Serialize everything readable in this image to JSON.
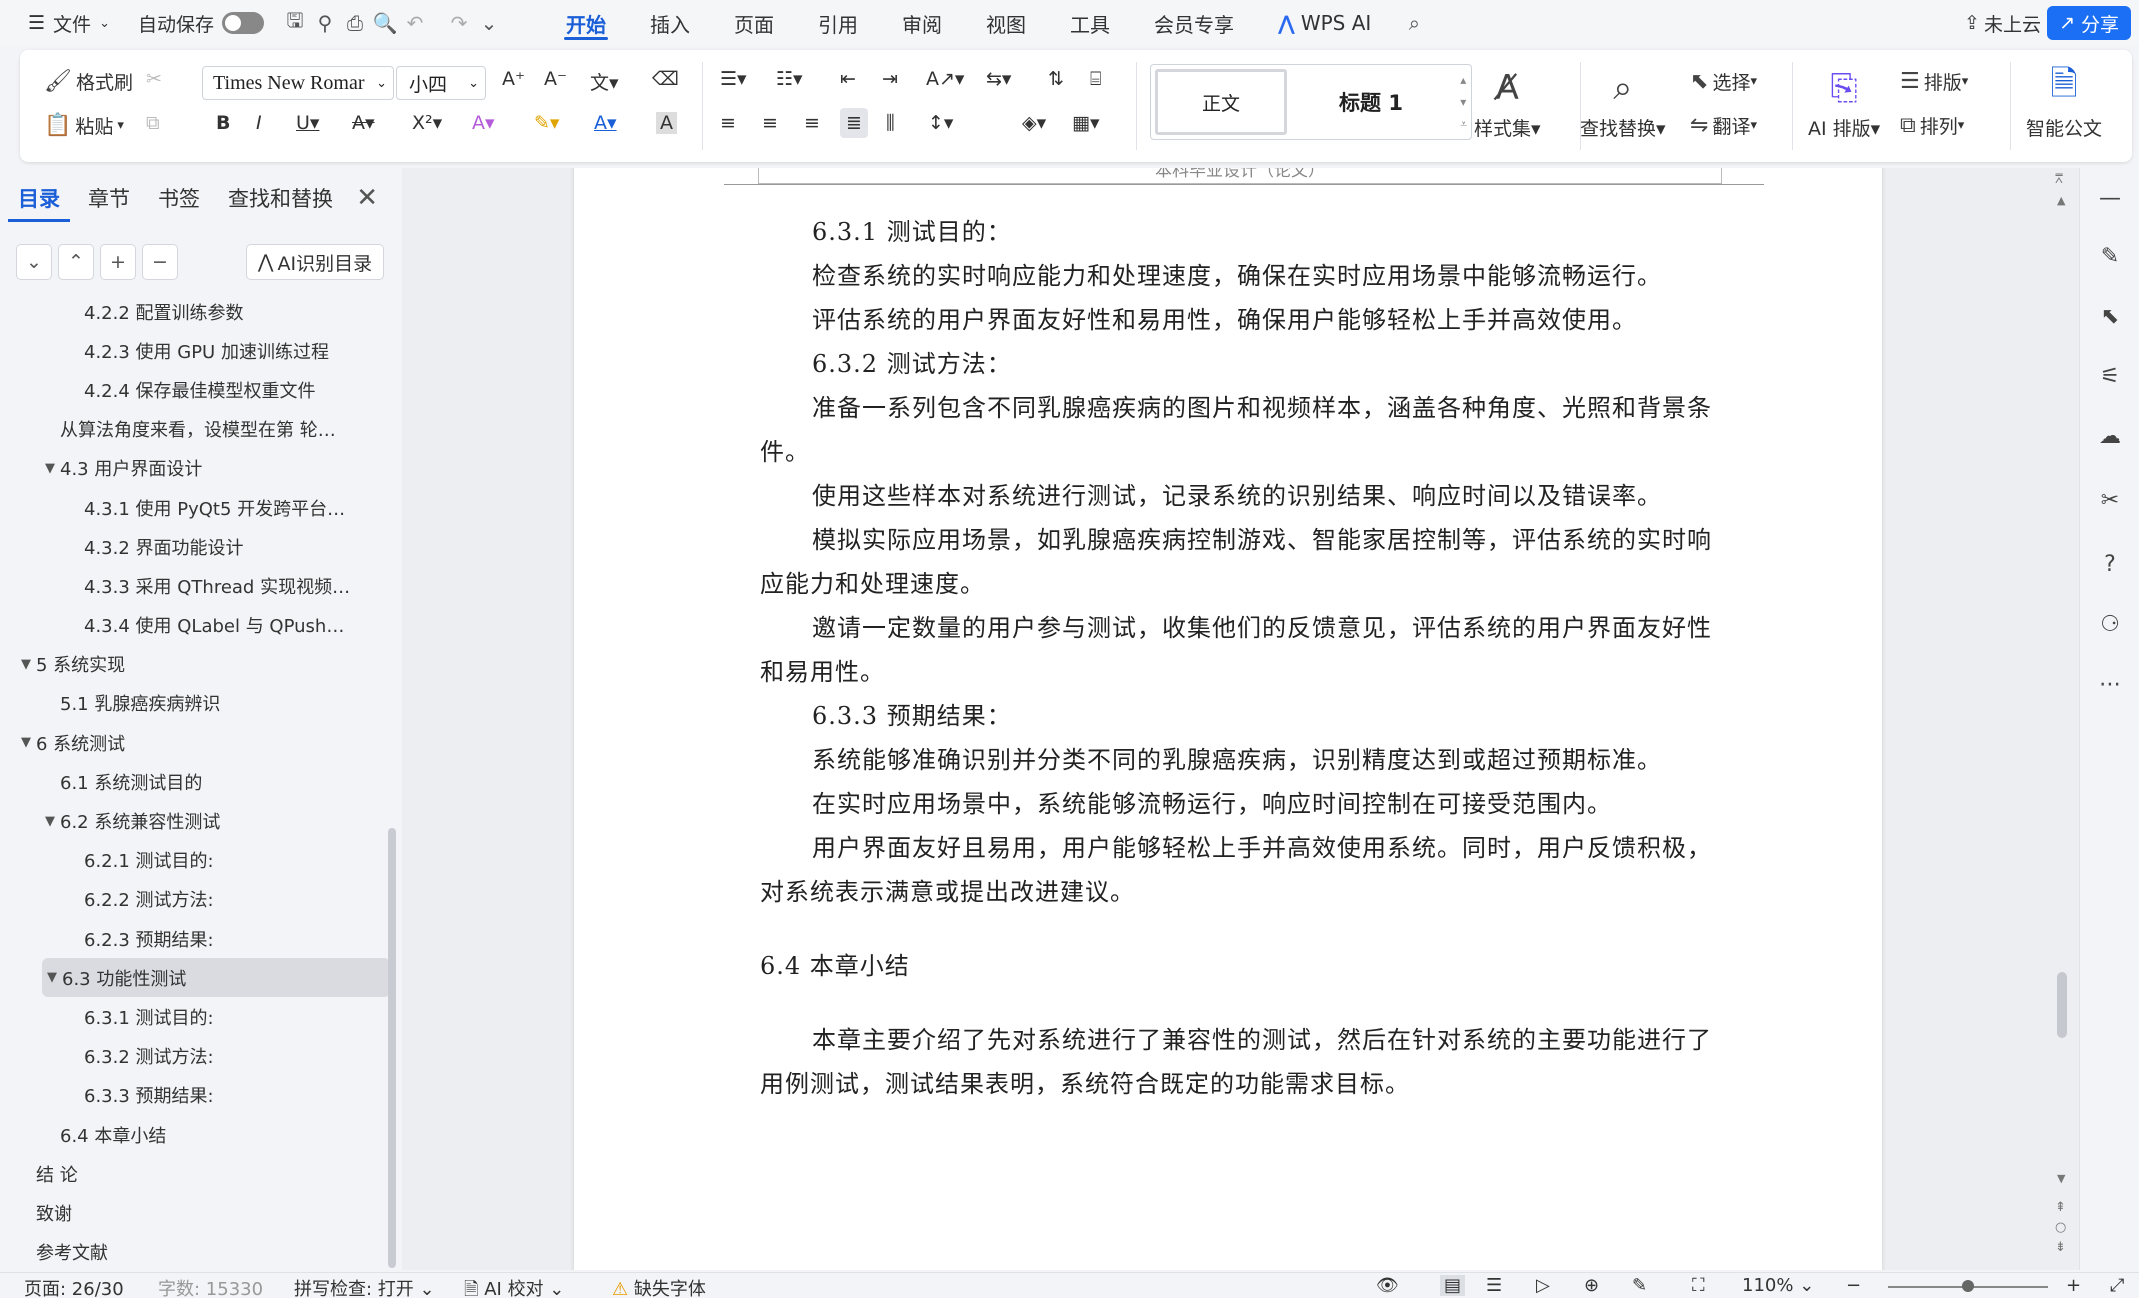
{
  "menubar": {
    "menu_label": "文件",
    "autosave_label": "自动保存",
    "tabs": [
      "开始",
      "插入",
      "页面",
      "引用",
      "审阅",
      "视图",
      "工具",
      "会员专享",
      "WPS AI"
    ],
    "active_tab": "开始",
    "cloud_label": "未上云",
    "share_label": "分享"
  },
  "ribbon": {
    "format_painter": "格式刷",
    "paste": "粘贴",
    "font_name": "Times New Romar",
    "font_size": "小四",
    "style_normal": "正文",
    "style_heading1": "标题 1",
    "style_set": "样式集",
    "find_replace": "查找替换",
    "select": "选择",
    "translate": "翻译",
    "ai_layout": "AI 排版",
    "typeset": "排版",
    "arrange": "排列",
    "smart_doc": "智能公文"
  },
  "nav": {
    "tabs": [
      "目录",
      "章节",
      "书签",
      "查找和替换"
    ],
    "active_tab": "目录",
    "ai_toc_label": "AI识别目录",
    "items": [
      {
        "text": "4.2.2 配置训练参数",
        "level": 3,
        "caret": ""
      },
      {
        "text": "4.2.3 使用 GPU 加速训练过程",
        "level": 3,
        "caret": ""
      },
      {
        "text": "4.2.4 保存最佳模型权重文件",
        "level": 3,
        "caret": ""
      },
      {
        "text": "从算法角度来看，设模型在第 轮…",
        "level": 2,
        "caret": ""
      },
      {
        "text": "4.3 用户界面设计",
        "level": 2,
        "caret": "▼"
      },
      {
        "text": "4.3.1 使用 PyQt5 开发跨平台…",
        "level": 3,
        "caret": ""
      },
      {
        "text": "4.3.2 界面功能设计",
        "level": 3,
        "caret": ""
      },
      {
        "text": "4.3.3 采用 QThread 实现视频…",
        "level": 3,
        "caret": ""
      },
      {
        "text": "4.3.4 使用 QLabel 与 QPush…",
        "level": 3,
        "caret": ""
      },
      {
        "text": "5 系统实现",
        "level": 1,
        "caret": "▼"
      },
      {
        "text": "5.1 乳腺癌疾病辨识",
        "level": 2,
        "caret": ""
      },
      {
        "text": "6 系统测试",
        "level": 1,
        "caret": "▼"
      },
      {
        "text": "6.1 系统测试目的",
        "level": 2,
        "caret": ""
      },
      {
        "text": "6.2 系统兼容性测试",
        "level": 2,
        "caret": "▼"
      },
      {
        "text": "6.2.1 测试目的:",
        "level": 3,
        "caret": ""
      },
      {
        "text": "6.2.2 测试方法:",
        "level": 3,
        "caret": ""
      },
      {
        "text": "6.2.3 预期结果:",
        "level": 3,
        "caret": ""
      },
      {
        "text": "6.3 功能性测试",
        "level": 2,
        "caret": "▼",
        "selected": true
      },
      {
        "text": "6.3.1 测试目的:",
        "level": 3,
        "caret": ""
      },
      {
        "text": "6.3.2 测试方法:",
        "level": 3,
        "caret": ""
      },
      {
        "text": "6.3.3 预期结果:",
        "level": 3,
        "caret": ""
      },
      {
        "text": "6.4 本章小结",
        "level": 2,
        "caret": ""
      },
      {
        "text": "结  论",
        "level": 1,
        "caret": ""
      },
      {
        "text": "致谢",
        "level": 1,
        "caret": ""
      },
      {
        "text": "参考文献",
        "level": 1,
        "caret": ""
      }
    ]
  },
  "document": {
    "header_text": "本科毕业设计（论文）",
    "paragraphs": [
      {
        "text": "6.3.1 测试目的：",
        "indent": true
      },
      {
        "text": "检查系统的实时响应能力和处理速度，确保在实时应用场景中能够流畅运行。",
        "indent": true
      },
      {
        "text": "评估系统的用户界面友好性和易用性，确保用户能够轻松上手并高效使用。",
        "indent": true
      },
      {
        "text": "6.3.2 测试方法：",
        "indent": true
      },
      {
        "text": "准备一系列包含不同乳腺癌疾病的图片和视频样本，涵盖各种角度、光照和背景条件。",
        "indent": true
      },
      {
        "text": "使用这些样本对系统进行测试，记录系统的识别结果、响应时间以及错误率。",
        "indent": true
      },
      {
        "text": "模拟实际应用场景，如乳腺癌疾病控制游戏、智能家居控制等，评估系统的实时响应能力和处理速度。",
        "indent": true
      },
      {
        "text": "邀请一定数量的用户参与测试，收集他们的反馈意见，评估系统的用户界面友好性和易用性。",
        "indent": true
      },
      {
        "text": "6.3.3 预期结果：",
        "indent": true
      },
      {
        "text": "系统能够准确识别并分类不同的乳腺癌疾病，识别精度达到或超过预期标准。",
        "indent": true
      },
      {
        "text": "在实时应用场景中，系统能够流畅运行，响应时间控制在可接受范围内。",
        "indent": true
      },
      {
        "text": "用户界面友好且易用，用户能够轻松上手并高效使用系统。同时，用户反馈积极，对系统表示满意或提出改进建议。",
        "indent": true
      }
    ],
    "section_heading": "6.4  本章小结",
    "summary": "本章主要介绍了先对系统进行了兼容性的测试，然后在针对系统的主要功能进行了用例测试，测试结果表明，系统符合既定的功能需求目标。"
  },
  "status": {
    "page": "页面: 26/30",
    "words": "字数: 15330",
    "spellcheck": "拼写检查: 打开",
    "ai_proof": "AI 校对",
    "missing_font": "缺失字体",
    "zoom": "110%"
  },
  "colors": {
    "accent": "#1a5fd7",
    "share_bg": "#1a6ff5"
  }
}
